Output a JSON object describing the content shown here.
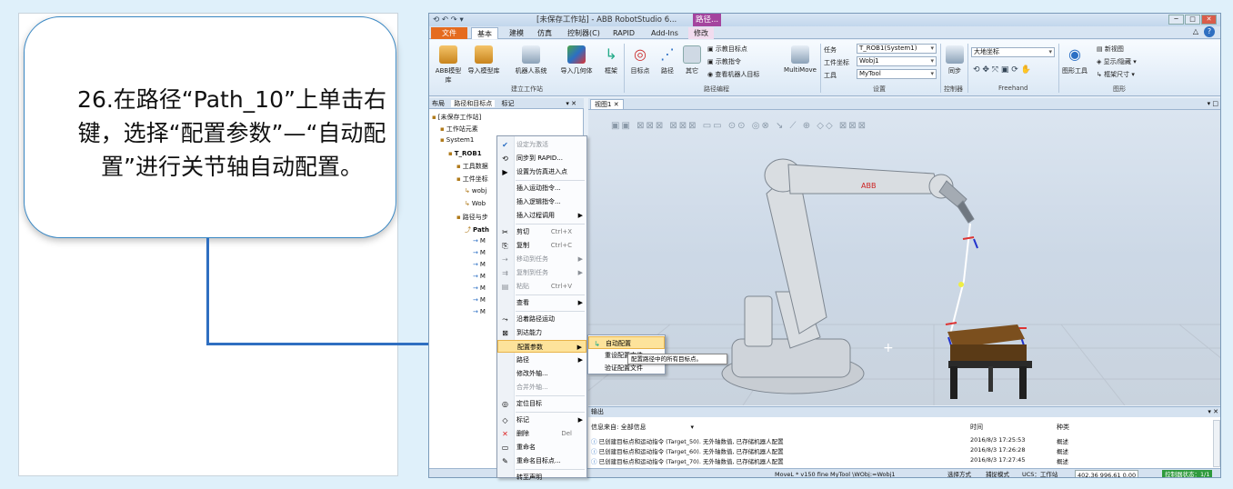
{
  "callout": {
    "text": "26.在路径“Path_10”上单击右键，选择“配置参数”—“自动配置”进行关节轴自动配置。"
  },
  "app": {
    "title": "[未保存工作站] - ABB RobotStudio 6...",
    "context_title": "路径...",
    "tabs": [
      "文件 (F)",
      "基本",
      "建模",
      "仿真",
      "控制器(C)",
      "RAPID",
      "Add-Ins",
      "修改"
    ],
    "ribbon": {
      "buttons": [
        "ABB模型库",
        "导入模型库",
        "机器人系统",
        "导入几何体",
        "框架",
        "目标点",
        "路径",
        "其它",
        "MultiMove",
        "同步",
        "图形工具"
      ],
      "path_items": [
        "示教目标点",
        "示教指令",
        "查看机器人目标"
      ],
      "settings": {
        "task_label": "任务",
        "task_value": "T_ROB1(System1)",
        "wobj_label": "工件坐标",
        "wobj_value": "Wobj1",
        "tool_label": "工具",
        "tool_value": "MyTool"
      },
      "freehand_combo": "大地坐标",
      "graphics_items": [
        "新视图",
        "显示/隐藏",
        "框架尺寸"
      ],
      "groups": [
        "建立工作站",
        "路径编程",
        "设置",
        "控制器",
        "Freehand",
        "图形"
      ]
    },
    "left_tabs": [
      "布局",
      "路径和目标点",
      "标记"
    ],
    "tree": [
      {
        "label": "[未保存工作站]",
        "indent": 0
      },
      {
        "label": "工作站元素",
        "indent": 1
      },
      {
        "label": "System1",
        "indent": 1
      },
      {
        "label": "T_ROB1",
        "indent": 2
      },
      {
        "label": "工具数据",
        "indent": 3
      },
      {
        "label": "工件坐标",
        "indent": 3
      },
      {
        "label": "wobj",
        "indent": 4
      },
      {
        "label": "Wob",
        "indent": 4
      },
      {
        "label": "路径与步",
        "indent": 3
      },
      {
        "label": "Path",
        "indent": 4
      },
      {
        "label": "M",
        "indent": 5
      },
      {
        "label": "M",
        "indent": 5
      },
      {
        "label": "M",
        "indent": 5
      },
      {
        "label": "M",
        "indent": 5
      },
      {
        "label": "M",
        "indent": 5
      },
      {
        "label": "M",
        "indent": 5
      },
      {
        "label": "M",
        "indent": 5
      }
    ],
    "view_tab": "视图1",
    "context_menu": [
      {
        "label": "设定为激活",
        "disabled": true,
        "icon": "check"
      },
      {
        "label": "同步到 RAPID...",
        "icon": "sync"
      },
      {
        "label": "设置为仿真进入点",
        "icon": "entry"
      },
      {
        "sep": true
      },
      {
        "label": "插入运动指令...",
        "icon": ""
      },
      {
        "label": "插入逻辑指令...",
        "icon": ""
      },
      {
        "label": "插入过程调用",
        "arrow": true,
        "icon": ""
      },
      {
        "sep": true
      },
      {
        "label": "剪切",
        "shortcut": "Ctrl+X",
        "icon": "cut"
      },
      {
        "label": "复制",
        "shortcut": "Ctrl+C",
        "icon": "copy"
      },
      {
        "label": "移动到任务",
        "arrow": true,
        "disabled": true,
        "icon": "move"
      },
      {
        "label": "复制到任务",
        "arrow": true,
        "disabled": true,
        "icon": "copyto"
      },
      {
        "label": "粘贴",
        "shortcut": "Ctrl+V",
        "disabled": true,
        "icon": "paste"
      },
      {
        "sep": true
      },
      {
        "label": "查看",
        "arrow": true,
        "icon": ""
      },
      {
        "sep": true
      },
      {
        "label": "沿着路径运动",
        "icon": "move-along"
      },
      {
        "label": "到达能力",
        "icon": "reach"
      },
      {
        "label": "配置参数",
        "arrow": true,
        "highlight": true,
        "icon": ""
      },
      {
        "label": "路径",
        "arrow": true,
        "icon": ""
      },
      {
        "label": "修改外轴...",
        "icon": ""
      },
      {
        "label": "合并外轴...",
        "disabled": true,
        "icon": ""
      },
      {
        "sep": true
      },
      {
        "label": "定位目标",
        "icon": "locate"
      },
      {
        "sep": true
      },
      {
        "label": "标记",
        "arrow": true,
        "icon": "tag"
      },
      {
        "label": "删除",
        "shortcut": "Del",
        "icon": "delete"
      },
      {
        "label": "重命名",
        "icon": "rename"
      },
      {
        "label": "重命名目标点...",
        "icon": "rename-target"
      },
      {
        "sep": true
      },
      {
        "label": "转至声明",
        "icon": ""
      }
    ],
    "submenu": [
      {
        "label": "自动配置",
        "highlight": true
      },
      {
        "label": "重设配置文件"
      },
      {
        "label": "验证配置文件"
      }
    ],
    "tooltip": "配置路径中的所有目标点。",
    "output": {
      "title": "输出",
      "filter": "信息来自: 全部信息",
      "col_time": "时间",
      "col_type": "种类",
      "rows": [
        {
          "msg": "已创建目标点和运动指令 (Target_50). 无外轴数值, 已存储机器人配置",
          "time": "2016/8/3 17:25:53",
          "type": "概述"
        },
        {
          "msg": "已创建目标点和运动指令 (Target_60). 无外轴数值, 已存储机器人配置",
          "time": "2016/8/3 17:26:28",
          "type": "概述"
        },
        {
          "msg": "已创建目标点和运动指令 (Target_70). 无外轴数值, 已存储机器人配置",
          "time": "2016/8/3 17:27:45",
          "type": "概述"
        }
      ]
    },
    "status": {
      "instruction": "MoveL * v150 fine MyTool \\WObj:=Wobj1",
      "mode": "选择方式",
      "snap": "捕捉模式",
      "ucs": "UCS：工作站",
      "coords": "402.36  996.61  0.00",
      "controller": "控制器状态：1/1"
    }
  }
}
